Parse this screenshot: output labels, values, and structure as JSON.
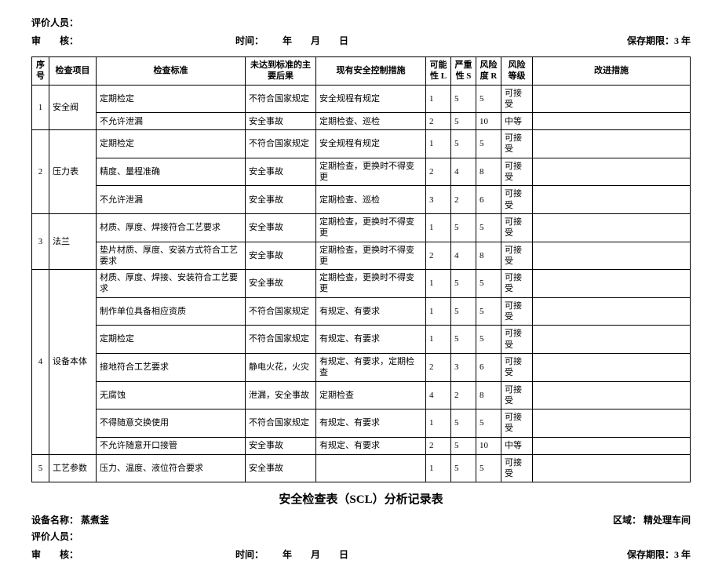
{
  "header": {
    "evaluator_label": "评价人员：",
    "reviewer_label": "审　　核：",
    "time_label": "时间：",
    "year_label": "年",
    "month_label": "月",
    "day_label": "日",
    "retention_label": "保存期限：3 年"
  },
  "table": {
    "columns": {
      "no": "序号",
      "item": "检查项目",
      "standard": "检查标准",
      "consequence": "未达到标准的主要后果",
      "control": "现有安全控制措施",
      "L": "可能性 L",
      "S": "严重性 S",
      "R": "风险度 R",
      "grade": "风险等级",
      "improve": "改进措施"
    },
    "groups": [
      {
        "no": "1",
        "item": "安全阀",
        "rows": [
          {
            "standard": "定期检定",
            "consequence": "不符合国家规定",
            "control": "安全规程有规定",
            "L": "1",
            "S": "5",
            "R": "5",
            "grade": "可接受",
            "improve": ""
          },
          {
            "standard": "不允许泄漏",
            "consequence": "安全事故",
            "control": "定期检查、巡检",
            "L": "2",
            "S": "5",
            "R": "10",
            "grade": "中等",
            "improve": ""
          }
        ]
      },
      {
        "no": "2",
        "item": "压力表",
        "rows": [
          {
            "standard": "定期检定",
            "consequence": "不符合国家规定",
            "control": "安全规程有规定",
            "L": "1",
            "S": "5",
            "R": "5",
            "grade": "可接受",
            "improve": ""
          },
          {
            "standard": "精度、量程准确",
            "consequence": "安全事故",
            "control": "定期检查，更换时不得变更",
            "L": "2",
            "S": "4",
            "R": "8",
            "grade": "可接受",
            "improve": ""
          },
          {
            "standard": "不允许泄漏",
            "consequence": "安全事故",
            "control": "定期检查、巡检",
            "L": "3",
            "S": "2",
            "R": "6",
            "grade": "可接受",
            "improve": ""
          }
        ]
      },
      {
        "no": "3",
        "item": "法兰",
        "rows": [
          {
            "standard": "材质、厚度、焊接符合工艺要求",
            "consequence": "安全事故",
            "control": "定期检查，更换时不得变更",
            "L": "1",
            "S": "5",
            "R": "5",
            "grade": "可接受",
            "improve": ""
          },
          {
            "standard": "垫片材质、厚度、安装方式符合工艺要求",
            "consequence": "安全事故",
            "control": "定期检查，更换时不得变更",
            "L": "2",
            "S": "4",
            "R": "8",
            "grade": "可接受",
            "improve": ""
          }
        ]
      },
      {
        "no": "4",
        "item": "设备本体",
        "rows": [
          {
            "standard": "材质、厚度、焊接、安装符合工艺要求",
            "consequence": "安全事故",
            "control": "定期检查，更换时不得变更",
            "L": "1",
            "S": "5",
            "R": "5",
            "grade": "可接受",
            "improve": ""
          },
          {
            "standard": "制作单位具备相应资质",
            "consequence": "不符合国家规定",
            "control": "有规定、有要求",
            "L": "1",
            "S": "5",
            "R": "5",
            "grade": "可接受",
            "improve": ""
          },
          {
            "standard": "定期检定",
            "consequence": "不符合国家规定",
            "control": "有规定、有要求",
            "L": "1",
            "S": "5",
            "R": "5",
            "grade": "可接受",
            "improve": ""
          },
          {
            "standard": "接地符合工艺要求",
            "consequence": "静电火花，火灾",
            "control": "有规定、有要求，定期检查",
            "L": "2",
            "S": "3",
            "R": "6",
            "grade": "可接受",
            "improve": ""
          },
          {
            "standard": "无腐蚀",
            "consequence": "泄漏，安全事故",
            "control": "定期检查",
            "L": "4",
            "S": "2",
            "R": "8",
            "grade": "可接受",
            "improve": ""
          },
          {
            "standard": "不得随意交换使用",
            "consequence": "不符合国家规定",
            "control": "有规定、有要求",
            "L": "1",
            "S": "5",
            "R": "5",
            "grade": "可接受",
            "improve": ""
          },
          {
            "standard": "不允许随意开口接管",
            "consequence": "安全事故",
            "control": "有规定、有要求",
            "L": "2",
            "S": "5",
            "R": "10",
            "grade": "中等",
            "improve": ""
          }
        ]
      },
      {
        "no": "5",
        "item": "工艺参数",
        "rows": [
          {
            "standard": "压力、温度、液位符合要求",
            "consequence": "安全事故",
            "control": "",
            "L": "1",
            "S": "5",
            "R": "5",
            "grade": "可接受",
            "improve": ""
          }
        ]
      }
    ]
  },
  "title2": "安全检查表（SCL）分析记录表",
  "footer": {
    "equip_label": "设备名称：",
    "equip_value": "蒸煮釜",
    "area_label": "区域：",
    "area_value": "精处理车间"
  }
}
